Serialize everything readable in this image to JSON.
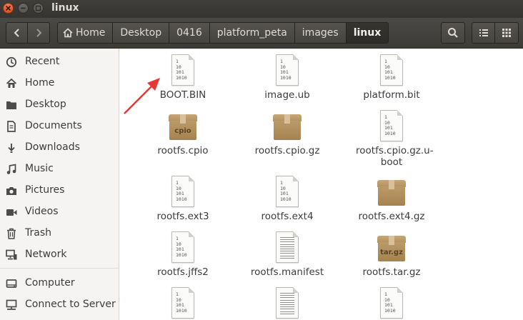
{
  "window": {
    "title": "linux"
  },
  "toolbar": {
    "breadcrumbs": [
      "Home",
      "Desktop",
      "0416",
      "platform_peta",
      "images",
      "linux"
    ]
  },
  "sidebar": {
    "items": [
      {
        "label": "Recent",
        "icon": "clock-icon"
      },
      {
        "label": "Home",
        "icon": "home-icon"
      },
      {
        "label": "Desktop",
        "icon": "folder-icon"
      },
      {
        "label": "Documents",
        "icon": "document-icon"
      },
      {
        "label": "Downloads",
        "icon": "download-icon"
      },
      {
        "label": "Music",
        "icon": "music-icon"
      },
      {
        "label": "Pictures",
        "icon": "camera-icon"
      },
      {
        "label": "Videos",
        "icon": "video-icon"
      },
      {
        "label": "Trash",
        "icon": "trash-icon"
      },
      {
        "label": "Network",
        "icon": "network-icon"
      },
      {
        "label": "Computer",
        "icon": "computer-icon"
      },
      {
        "label": "Connect to Server",
        "icon": "server-icon"
      }
    ]
  },
  "files": [
    {
      "name": "BOOT.BIN",
      "type": "binary"
    },
    {
      "name": "image.ub",
      "type": "binary"
    },
    {
      "name": "platform.bit",
      "type": "binary"
    },
    {
      "name": "rootfs.cpio",
      "type": "archive",
      "badge": "cpio"
    },
    {
      "name": "rootfs.cpio.gz",
      "type": "archive",
      "badge": ""
    },
    {
      "name": "rootfs.cpio.gz.u-boot",
      "type": "binary"
    },
    {
      "name": "rootfs.ext3",
      "type": "binary"
    },
    {
      "name": "rootfs.ext4",
      "type": "binary"
    },
    {
      "name": "rootfs.ext4.gz",
      "type": "archive",
      "badge": ""
    },
    {
      "name": "rootfs.jffs2",
      "type": "binary"
    },
    {
      "name": "rootfs.manifest",
      "type": "text"
    },
    {
      "name": "rootfs.tar.gz",
      "type": "archive",
      "badge": "tar.gz"
    },
    {
      "name": "",
      "type": "binary"
    },
    {
      "name": "",
      "type": "text"
    },
    {
      "name": "",
      "type": "binary"
    }
  ],
  "binary_glyph": [
    "1",
    "10",
    "101",
    "1010"
  ],
  "colors": {
    "annotation_arrow": "#e53935",
    "titlebar": "#3c3b37",
    "close_button": "#e95420"
  }
}
